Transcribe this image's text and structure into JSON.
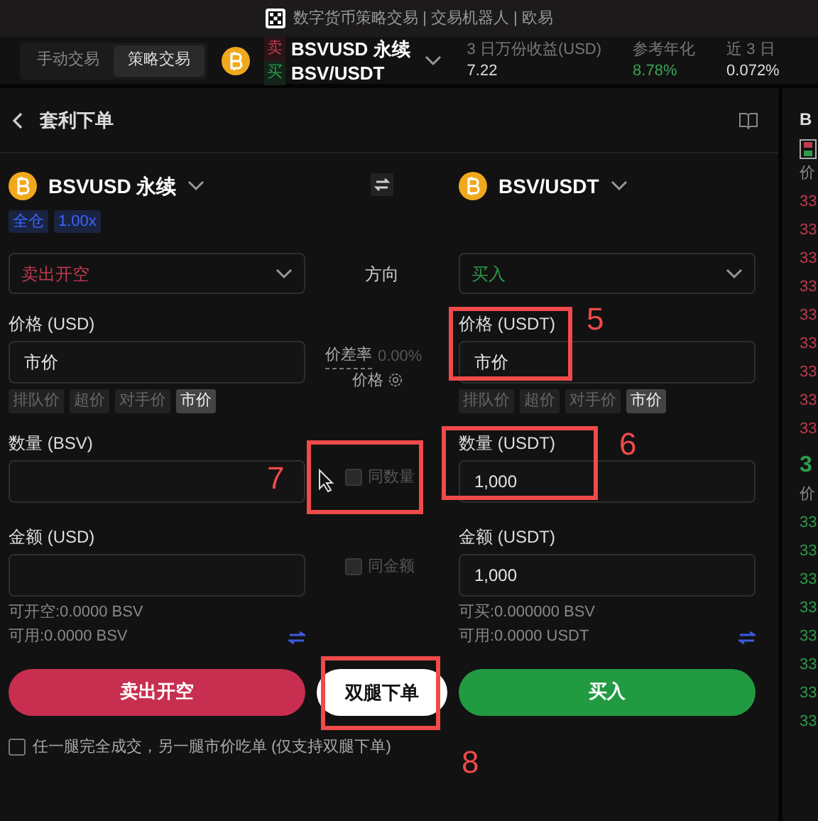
{
  "title_bar": {
    "title": "数字货币策略交易 | 交易机器人 | 欧易"
  },
  "mode_tabs": [
    {
      "label": "手动交易",
      "selected": false
    },
    {
      "label": "策略交易",
      "selected": true
    }
  ],
  "pair": {
    "sell_tag": "卖",
    "sell_name": "BSVUSD 永续",
    "buy_tag": "买",
    "buy_name": "BSV/USDT"
  },
  "stats": [
    {
      "label": "3 日万份收益(USD)",
      "value": "7.22",
      "kind": "plain"
    },
    {
      "label": "参考年化",
      "value": "8.78%",
      "kind": "positive"
    },
    {
      "label": "近 3 日",
      "value": "0.072%",
      "kind": "plain"
    }
  ],
  "panel": {
    "title": "套利下单"
  },
  "legs": [
    {
      "coin": "BSVUSD 永续",
      "tags": [
        "全仓",
        "1.00x"
      ],
      "side": {
        "value": "卖出开空",
        "kind": "sell"
      },
      "price_label": "价格 (USD)",
      "price_value": "市价",
      "price_chips": [
        {
          "label": "排队价",
          "selected": false
        },
        {
          "label": "超价",
          "selected": false
        },
        {
          "label": "对手价",
          "selected": false
        },
        {
          "label": "市价",
          "selected": true
        }
      ],
      "qty_label": "数量 (BSV)",
      "amount_label": "金额 (USD)",
      "info": [
        "可开空:0.0000 BSV",
        "可用:0.0000 BSV"
      ],
      "submit": "卖出开空"
    },
    {
      "coin": "BSV/USDT",
      "side": {
        "value": "买入",
        "kind": "buy"
      },
      "price_label": "价格 (USDT)",
      "price_value": "市价",
      "price_chips": [
        {
          "label": "排队价",
          "selected": false
        },
        {
          "label": "超价",
          "selected": false
        },
        {
          "label": "对手价",
          "selected": false
        },
        {
          "label": "市价",
          "selected": true
        }
      ],
      "qty_label": "数量 (USDT)",
      "qty_value": "1,000",
      "amount_label": "金额 (USDT)",
      "amount_value": "1,000",
      "info": [
        "可买:0.000000 BSV",
        "可用:0.0000 USDT"
      ],
      "submit": "买入"
    }
  ],
  "middle": {
    "direction_label": "方向",
    "spread_label": "价差率",
    "spread_value": "0.00%",
    "price_label": "价格",
    "same_qty": {
      "label": "同数量",
      "checked": false
    },
    "same_amount": {
      "label": "同金额",
      "checked": false
    },
    "dual_button": "双腿下单"
  },
  "footer": {
    "label": "任一腿完全成交，另一腿市价吃单 (仅支持双腿下单)",
    "checked": false
  },
  "order_book": {
    "header": "B",
    "ask_col": "价",
    "asks": [
      "33",
      "33",
      "33",
      "33",
      "33",
      "33",
      "33",
      "33",
      "33"
    ],
    "last": "3",
    "bid_col": "价",
    "bids": [
      "33",
      "33",
      "33",
      "33",
      "33",
      "33",
      "33",
      "33"
    ]
  },
  "annotations": [
    {
      "label": "5"
    },
    {
      "label": "6"
    },
    {
      "label": "7"
    },
    {
      "label": "8"
    }
  ]
}
